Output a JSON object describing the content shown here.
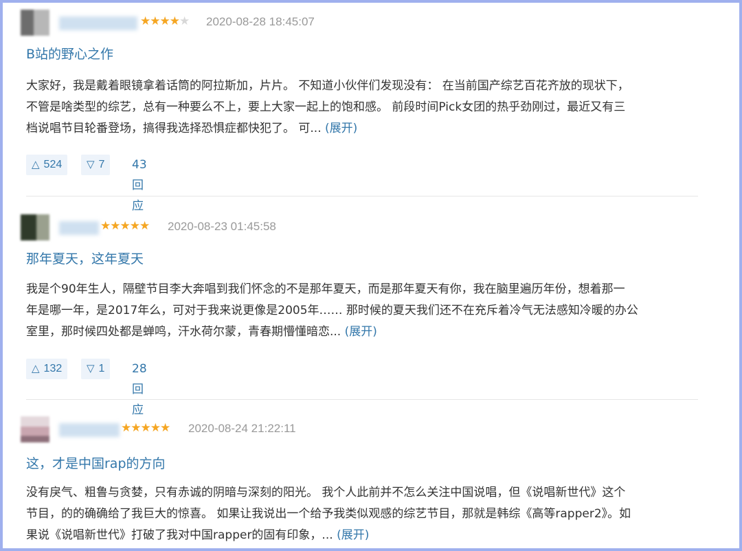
{
  "reviews": [
    {
      "rating": 4,
      "time": "2020-08-28 18:45:07",
      "title": "B站的野心之作",
      "lines": [
        "大家好，我是戴着眼镜拿着话筒的阿拉斯加，片片。 不知道小伙伴们发现没有： 在当前国产综艺百花齐放的现状下，",
        "不管是啥类型的综艺，总有一种要么不上，要上大家一起上的饱和感。 前段时间Pick女团的热乎劲刚过，最近又有三",
        "档说唱节目轮番登场，搞得我选择恐惧症都快犯了。 可... "
      ],
      "expand_label": "(展开)",
      "upvotes": "524",
      "downvotes": "7",
      "replies": "43回应"
    },
    {
      "rating": 5,
      "time": "2020-08-23 01:45:58",
      "title": "那年夏天，这年夏天",
      "lines": [
        "我是个90年生人，隔壁节目李大奔唱到我们怀念的不是那年夏天，而是那年夏天有你，我在脑里遍历年份，想着那一",
        "年是哪一年，是2017年么，可对于我来说更像是2005年…… 那时候的夏天我们还不在充斥着冷气无法感知冷暖的办公",
        "室里，那时候四处都是蝉鸣，汗水荷尔蒙，青春期懵懂暗恋... "
      ],
      "expand_label": "(展开)",
      "upvotes": "132",
      "downvotes": "1",
      "replies": "28回应"
    },
    {
      "rating": 5,
      "time": "2020-08-24 21:22:11",
      "title": "这，才是中国rap的方向",
      "lines": [
        "没有戾气、粗鲁与贪婪，只有赤诚的阴暗与深刻的阳光。 我个人此前并不怎么关注中国说唱，但《说唱新世代》这个",
        "节目，的的确确给了我巨大的惊喜。 如果让我说出一个给予我类似观感的综艺节目，那就是韩综《高等rapper2》。如",
        "果说《说唱新世代》打破了我对中国rapper的固有印象，... "
      ],
      "expand_label": "(展开)"
    }
  ],
  "colors": {
    "link": "#3377aa",
    "star": "#f5a623",
    "frame": "#9fb0ee"
  },
  "icons": {
    "up": "up-triangle-icon",
    "down": "down-triangle-icon"
  }
}
